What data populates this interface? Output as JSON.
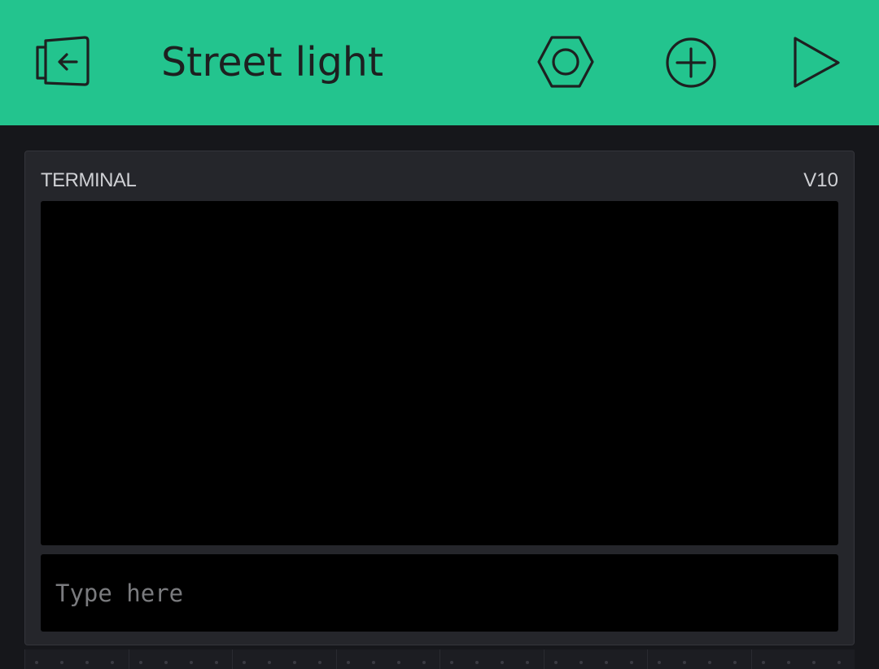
{
  "header": {
    "title": "Street light",
    "background_color": "#23c48e",
    "icons": {
      "back": "exit-icon",
      "settings": "hexagon-nut-icon",
      "add": "circle-plus-icon",
      "play": "play-triangle-icon"
    }
  },
  "widget": {
    "type_label": "TERMINAL",
    "pin": "V10",
    "output_text": "",
    "input": {
      "value": "",
      "placeholder": "Type here"
    }
  },
  "colors": {
    "background": "#16171b",
    "widget_background": "#25262b",
    "terminal_background": "#000000"
  }
}
